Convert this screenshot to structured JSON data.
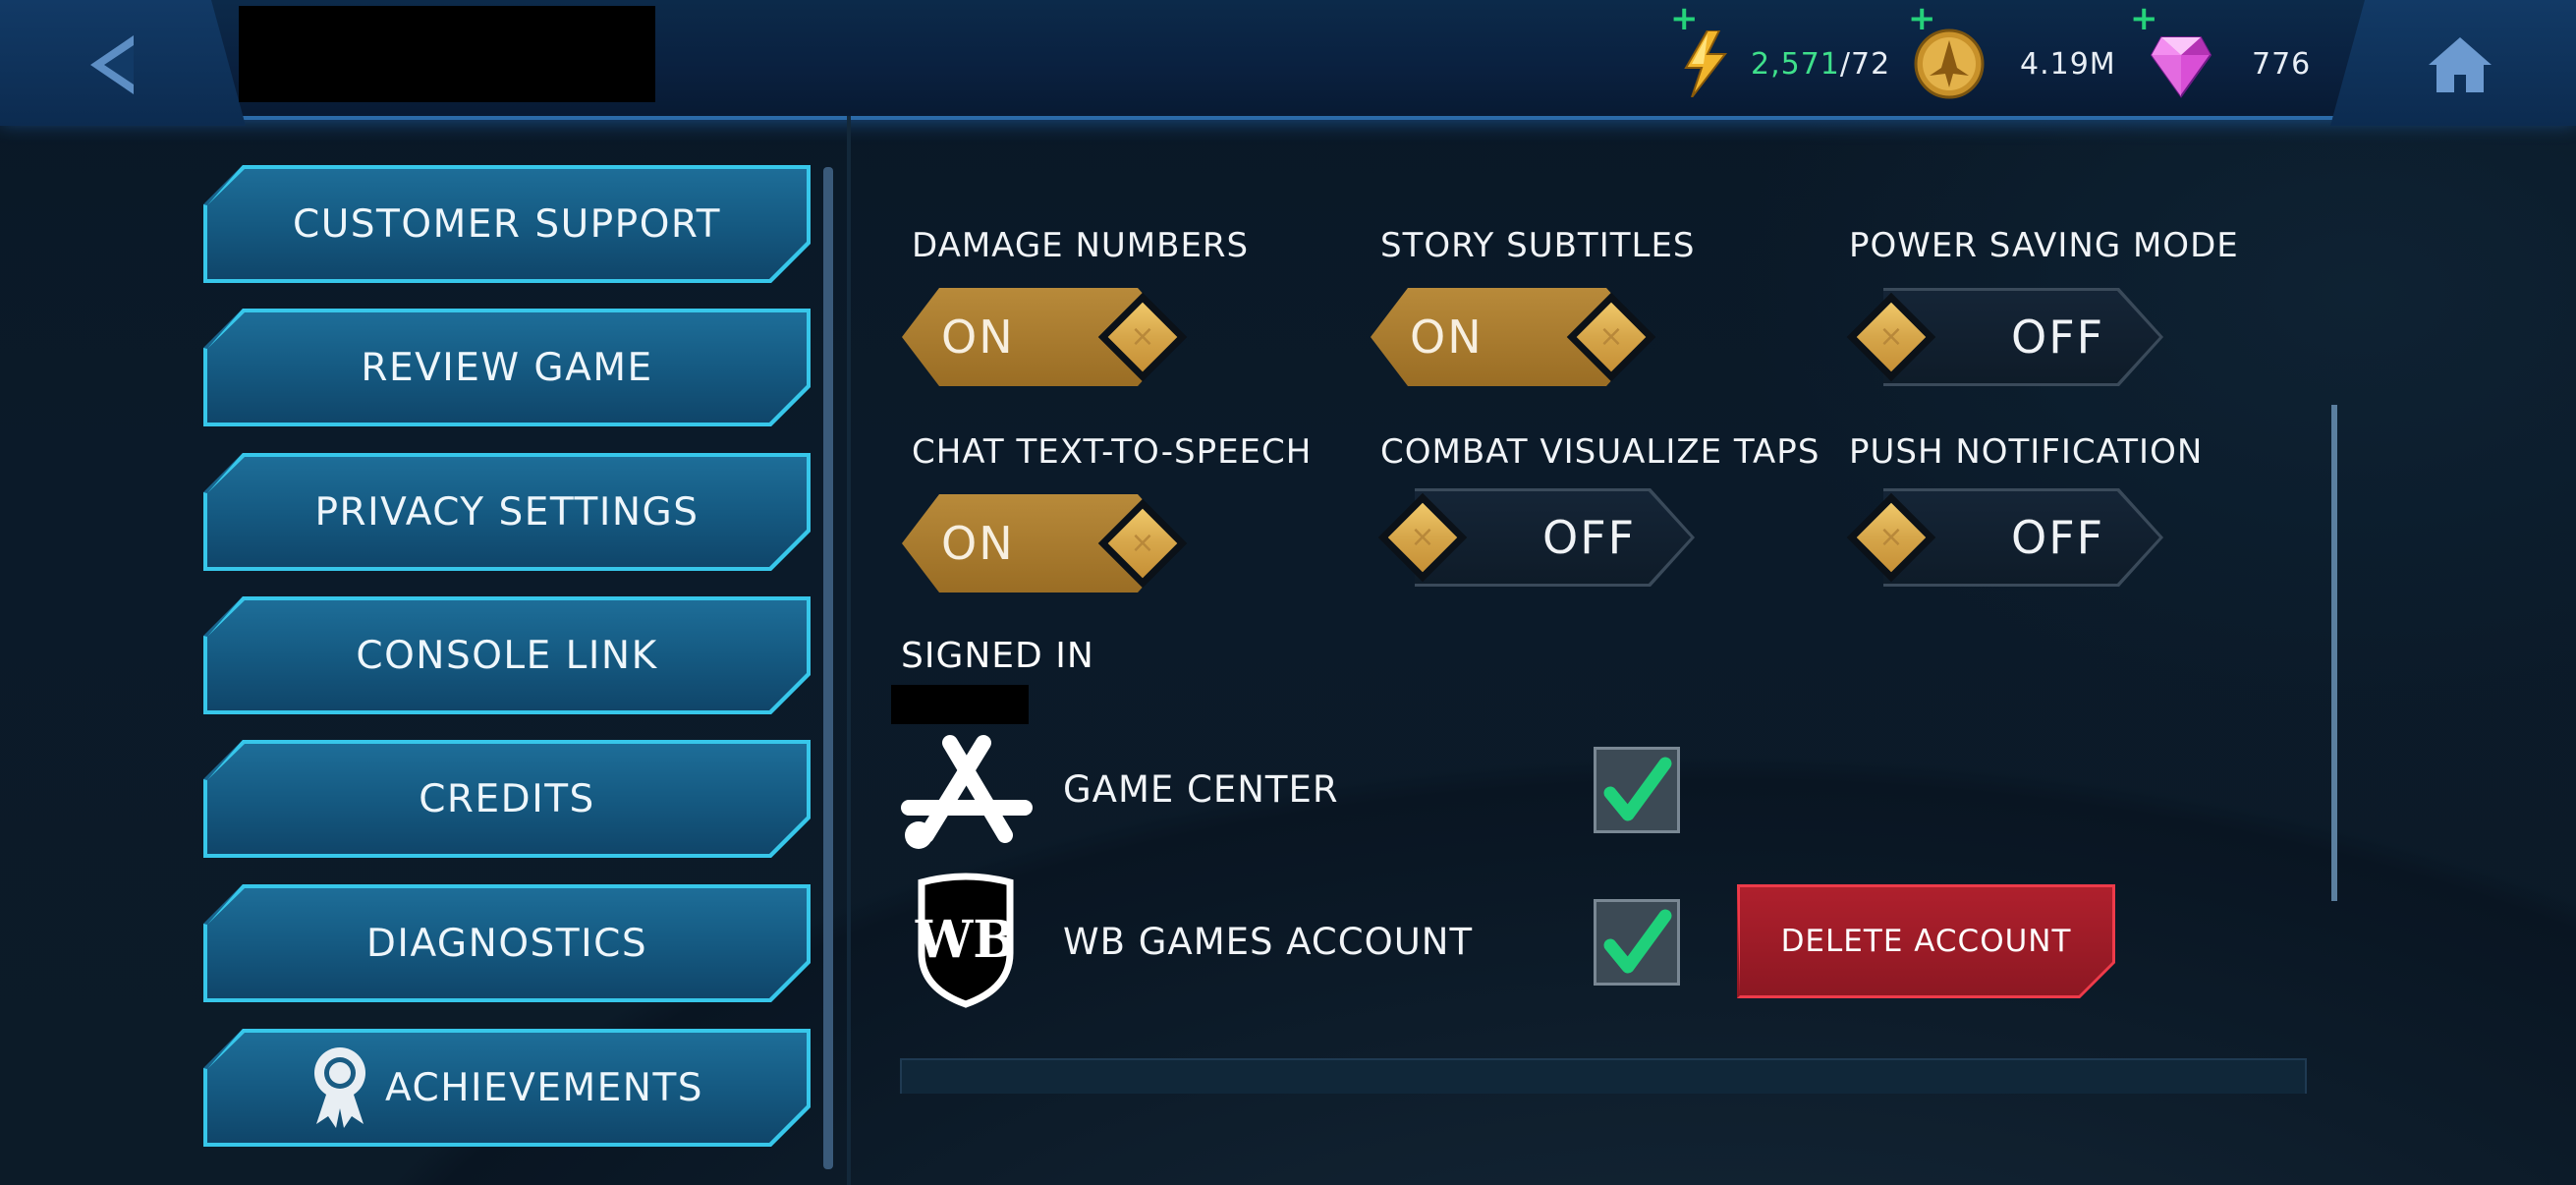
{
  "header": {
    "energy": {
      "current": "2,571",
      "separator_max": "/72"
    },
    "gold": "4.19M",
    "gems": "776",
    "plus_symbol": "+"
  },
  "menu": {
    "items": [
      {
        "label": "CUSTOMER SUPPORT"
      },
      {
        "label": "REVIEW GAME"
      },
      {
        "label": "PRIVACY SETTINGS"
      },
      {
        "label": "CONSOLE LINK"
      },
      {
        "label": "CREDITS"
      },
      {
        "label": "DIAGNOSTICS"
      },
      {
        "label": "ACHIEVEMENTS"
      }
    ]
  },
  "settings": [
    {
      "label": "DAMAGE NUMBERS",
      "state": "ON"
    },
    {
      "label": "STORY SUBTITLES",
      "state": "ON"
    },
    {
      "label": "POWER SAVING MODE",
      "state": "OFF"
    },
    {
      "label": "CHAT TEXT-TO-SPEECH",
      "state": "ON"
    },
    {
      "label": "COMBAT VISUALIZE TAPS",
      "state": "OFF"
    },
    {
      "label": "PUSH NOTIFICATION",
      "state": "OFF"
    }
  ],
  "accounts": {
    "title": "SIGNED IN",
    "items": [
      {
        "label": "GAME CENTER",
        "checked": true
      },
      {
        "label": "WB GAMES ACCOUNT",
        "checked": true
      }
    ],
    "delete_label": "DELETE ACCOUNT"
  },
  "toggle_x": "×",
  "colors": {
    "accent_gold": "#b88a3a",
    "menu_border": "#37c7ea",
    "delete_red": "#b0202d",
    "check_green": "#1fd07a"
  }
}
